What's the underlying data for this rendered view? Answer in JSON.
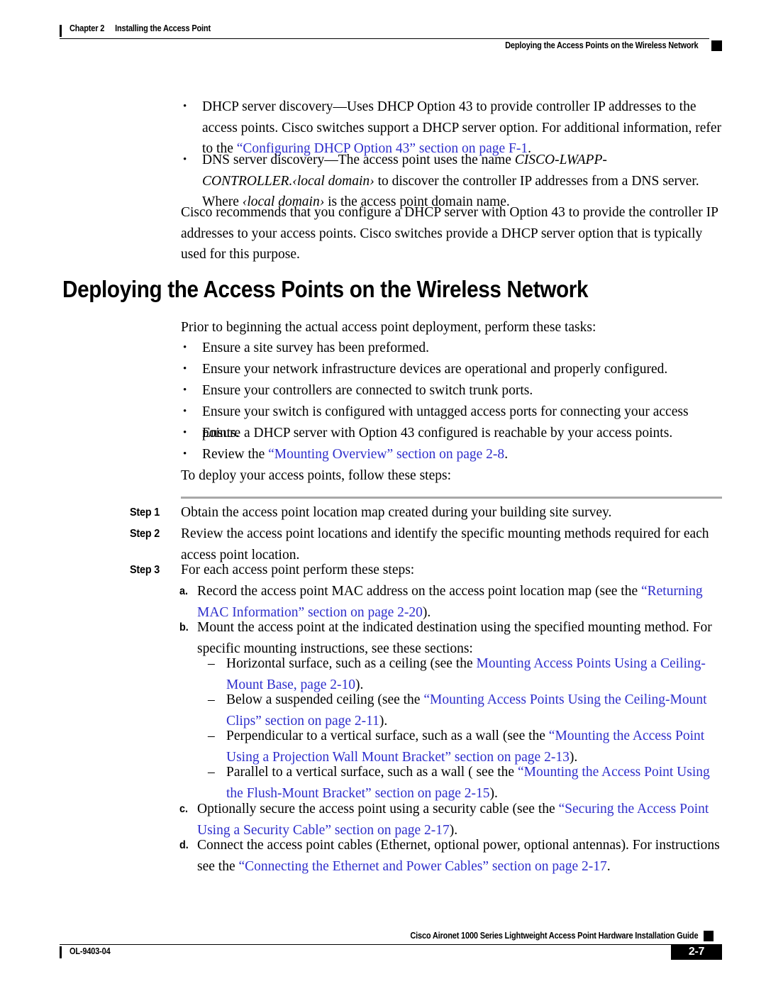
{
  "header": {
    "chapter_num": "Chapter 2",
    "chapter_title": "Installing the Access Point",
    "section_title": "Deploying the Access Points on the Wireless Network"
  },
  "footer": {
    "doc_id": "OL-9403-04",
    "guide_title": "Cisco Aironet 1000 Series Lightweight Access Point Hardware Installation Guide",
    "page_number": "2-7"
  },
  "colors": {
    "link": "#2f2fcc",
    "rule_gray": "#a8a8a8"
  },
  "intro_bullets": [
    {
      "mark": "•",
      "segments": [
        {
          "text": "DHCP server discovery—Uses DHCP Option 43 to provide controller IP addresses to the access points. Cisco switches support a DHCP server option. For additional information, refer to the ",
          "style": "normal"
        },
        {
          "text": "“Configuring DHCP Option 43” section on page F-1",
          "style": "link"
        },
        {
          "text": ".",
          "style": "normal"
        }
      ]
    },
    {
      "mark": "•",
      "segments": [
        {
          "text": "DNS server discovery—The access point uses the name ",
          "style": "normal"
        },
        {
          "text": "CISCO-LWAPP-CONTROLLER.‹local domain›",
          "style": "italic"
        },
        {
          "text": " to discover the controller IP addresses from a DNS server. Where ",
          "style": "normal"
        },
        {
          "text": "‹local domain›",
          "style": "italic"
        },
        {
          "text": " is the access point domain name.",
          "style": "normal"
        }
      ]
    }
  ],
  "recommend_para": "Cisco recommends that you configure a DHCP server with Option 43 to provide the controller IP addresses to your access points. Cisco switches provide a DHCP server option that is typically used for this purpose.",
  "section_heading": "Deploying the Access Points on the Wireless Network",
  "prior_para": "Prior to beginning the actual access point deployment, perform these tasks:",
  "task_bullets": [
    {
      "mark": "•",
      "segments": [
        {
          "text": "Ensure a site survey has been preformed.",
          "style": "normal"
        }
      ]
    },
    {
      "mark": "•",
      "segments": [
        {
          "text": "Ensure your network infrastructure devices are operational and properly configured.",
          "style": "normal"
        }
      ]
    },
    {
      "mark": "•",
      "segments": [
        {
          "text": "Ensure your controllers are connected to switch trunk ports.",
          "style": "normal"
        }
      ]
    },
    {
      "mark": "•",
      "segments": [
        {
          "text": "Ensure your switch is configured with untagged access ports for connecting your access points.",
          "style": "normal"
        }
      ]
    },
    {
      "mark": "•",
      "segments": [
        {
          "text": "Ensure a DHCP server with Option 43 configured is reachable by your access points.",
          "style": "normal"
        }
      ]
    },
    {
      "mark": "•",
      "segments": [
        {
          "text": "Review the ",
          "style": "normal"
        },
        {
          "text": "“Mounting Overview” section on page 2-8",
          "style": "link"
        },
        {
          "text": ".",
          "style": "normal"
        }
      ]
    }
  ],
  "deploy_para": "To deploy your access points, follow these steps:",
  "steps": [
    {
      "label": "Step 1",
      "segments": [
        {
          "text": "Obtain the access point location map created during your building site survey.",
          "style": "normal"
        }
      ]
    },
    {
      "label": "Step 2",
      "segments": [
        {
          "text": "Review the access point locations and identify the specific mounting methods required for each access point location.",
          "style": "normal"
        }
      ]
    },
    {
      "label": "Step 3",
      "segments": [
        {
          "text": "For each access point perform these steps:",
          "style": "normal"
        }
      ]
    }
  ],
  "substeps": [
    {
      "mark": "a.",
      "segments": [
        {
          "text": "Record the access point MAC address on the access point location map (see the ",
          "style": "normal"
        },
        {
          "text": "“Returning MAC Information” section on page 2-20",
          "style": "link"
        },
        {
          "text": ").",
          "style": "normal"
        }
      ]
    },
    {
      "mark": "b.",
      "segments": [
        {
          "text": "Mount the access point at the indicated destination using the specified mounting method. For specific mounting instructions, see these sections:",
          "style": "normal"
        }
      ]
    },
    {
      "mark": "c.",
      "segments": [
        {
          "text": "Optionally secure the access point using a security cable (see the ",
          "style": "normal"
        },
        {
          "text": "“Securing the Access Point Using a Security Cable” section on page 2-17",
          "style": "link"
        },
        {
          "text": ").",
          "style": "normal"
        }
      ]
    },
    {
      "mark": "d.",
      "segments": [
        {
          "text": "Connect the access point cables (Ethernet, optional power, optional antennas). For instructions see the ",
          "style": "normal"
        },
        {
          "text": "“Connecting the Ethernet and Power Cables” section on page 2-17",
          "style": "link"
        },
        {
          "text": ".",
          "style": "normal"
        }
      ]
    }
  ],
  "mount_options": [
    {
      "mark": "–",
      "segments": [
        {
          "text": "Horizontal surface, such as a ceiling (see the ",
          "style": "normal"
        },
        {
          "text": "Mounting Access Points Using a Ceiling-Mount Base, page 2-10",
          "style": "link"
        },
        {
          "text": ").",
          "style": "normal"
        }
      ]
    },
    {
      "mark": "–",
      "segments": [
        {
          "text": "Below a suspended ceiling (see the ",
          "style": "normal"
        },
        {
          "text": "“Mounting Access Points Using the Ceiling-Mount Clips” section on page 2-11",
          "style": "link"
        },
        {
          "text": ").",
          "style": "normal"
        }
      ]
    },
    {
      "mark": "–",
      "segments": [
        {
          "text": "Perpendicular to a vertical surface, such as a wall (see the ",
          "style": "normal"
        },
        {
          "text": "“Mounting the Access Point Using a Projection Wall Mount Bracket” section on page 2-13",
          "style": "link"
        },
        {
          "text": ").",
          "style": "normal"
        }
      ]
    },
    {
      "mark": "–",
      "segments": [
        {
          "text": "Parallel to a vertical surface, such as a wall ( see the ",
          "style": "normal"
        },
        {
          "text": "“Mounting the Access Point Using the Flush-Mount Bracket” section on page 2-15",
          "style": "link"
        },
        {
          "text": ").",
          "style": "normal"
        }
      ]
    }
  ]
}
